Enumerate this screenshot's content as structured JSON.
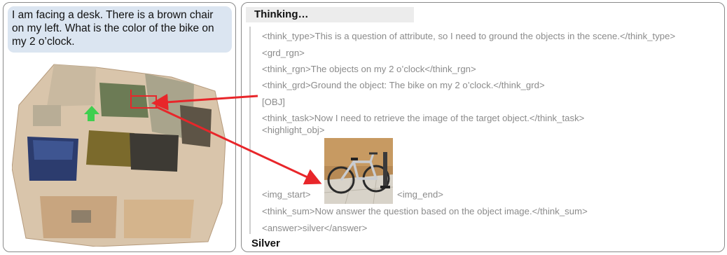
{
  "question": "I am facing a desk. There is a brown chair on my left. What is the color of the bike on my 2 o’clock.",
  "thinking": {
    "header": "Thinking…",
    "lines": {
      "think_type": "<think_type>This is a question of attribute, so I need to ground the objects in the scene.</think_type>",
      "grd_rgn": "<grd_rgn>",
      "think_rgn": "<think_rgn>The objects on my 2 o’clock</think_rgn>",
      "think_grd": "<think_grd>Ground the object: The bike on my 2 o’clock.</think_grd>",
      "obj": "[OBJ]",
      "think_task": "<think_task>Now I need to retrieve the image of the target object.</think_task>",
      "highlight_obj": "<highlight_obj>",
      "img_start": "<img_start>",
      "img_end": "<img_end>",
      "think_sum": "<think_sum>Now answer the question based on the object image.</think_sum>",
      "answer": "<answer>silver</answer>"
    }
  },
  "final_answer": "Silver",
  "colors": {
    "question_bg": "#dbe5f1",
    "header_bg": "#ececec",
    "arrow": "#e8262a",
    "panel_border": "#8a8a8a",
    "agent_marker": "#3fcf4f"
  },
  "icons": [
    "agent-position-marker",
    "target-box",
    "arrow"
  ]
}
